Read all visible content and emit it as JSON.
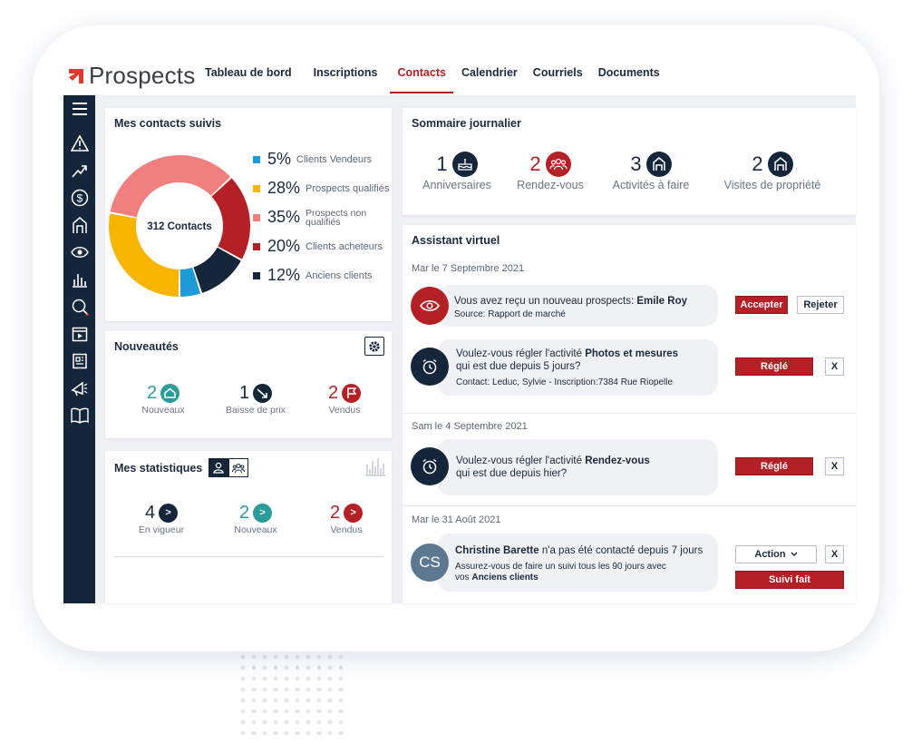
{
  "app": {
    "name": "Prospects"
  },
  "nav": {
    "items": [
      "Tableau de bord",
      "Inscriptions",
      "Contacts",
      "Calendrier",
      "Courriels",
      "Documents"
    ],
    "active": "Contacts"
  },
  "colors": {
    "accent": "#b32025",
    "navy": "#15253a",
    "teal": "#2a9d9b",
    "blue": "#1d9bd6",
    "yellow": "#f7b500",
    "salmon": "#f08080"
  },
  "contacts": {
    "title": "Mes contacts suivis",
    "center_label": "312 Contacts",
    "legend": [
      {
        "pct": "5%",
        "label": "Clients Vendeurs",
        "color": "#1d9bd6"
      },
      {
        "pct": "28%",
        "label": "Prospects qualifiés",
        "color": "#f7b500"
      },
      {
        "pct": "35%",
        "label": "Prospects non qualifiés",
        "color": "#f08080"
      },
      {
        "pct": "20%",
        "label": "Clients acheteurs",
        "color": "#b32025"
      },
      {
        "pct": "12%",
        "label": "Anciens clients",
        "color": "#15253a"
      }
    ]
  },
  "chart_data": {
    "type": "pie",
    "categories": [
      "Clients Vendeurs",
      "Prospects qualifiés",
      "Prospects non qualifiés",
      "Clients acheteurs",
      "Anciens clients"
    ],
    "values": [
      5,
      28,
      35,
      20,
      12
    ],
    "title": "Mes contacts suivis"
  },
  "news": {
    "title": "Nouveautés",
    "items": [
      {
        "num": "2",
        "label": "Nouveaux",
        "icon": "home-icon"
      },
      {
        "num": "1",
        "label": "Baisse de prix",
        "icon": "price-drop-icon"
      },
      {
        "num": "2",
        "label": "Vendus",
        "icon": "flag-icon"
      }
    ]
  },
  "stats": {
    "title": "Mes statistiques",
    "items": [
      {
        "num": "4",
        "label": "En vigueur",
        "badge": ">"
      },
      {
        "num": "2",
        "label": "Nouveaux",
        "badge": ">"
      },
      {
        "num": "2",
        "label": "Vendus",
        "badge": ">"
      }
    ]
  },
  "summary": {
    "title": "Sommaire journalier",
    "items": [
      {
        "num": "1",
        "label": "Anniversaires",
        "icon": "cake-icon"
      },
      {
        "num": "2",
        "label": "Rendez-vous",
        "icon": "people-icon"
      },
      {
        "num": "3",
        "label": "Activités à faire",
        "icon": "house-icon"
      },
      {
        "num": "2",
        "label": "Visites de propriété",
        "icon": "house-icon"
      }
    ]
  },
  "assistant": {
    "title": "Assistant virtuel",
    "groups": [
      {
        "date": "Mar le 7 Septembre 2021",
        "items": [
          {
            "pre": "Vous avez reçu un nouveau prospects: ",
            "bold": "Emile Roy",
            "post": "",
            "line2": "",
            "sub": "Source: Rapport de marché",
            "buttons": [
              "Accepter",
              "Rejeter"
            ]
          },
          {
            "pre": "Voulez-vous régler l'activité ",
            "bold": "Photos et mesures",
            "post": "",
            "line2": "qui est due depuis 5 jours?",
            "sub": "Contact: Leduc, Sylvie - Inscription:7384 Rue Riopelle",
            "buttons": [
              "Réglé",
              "X"
            ]
          }
        ]
      },
      {
        "date": "Sam le 4 Septembre 2021",
        "items": [
          {
            "pre": "Voulez-vous régler l'activité ",
            "bold": "Rendez-vous",
            "post": "",
            "line2": "qui est due depuis hier?",
            "sub": "",
            "buttons": [
              "Réglé",
              "X"
            ]
          }
        ]
      },
      {
        "date": "Mar le 31 Août 2021",
        "items": [
          {
            "pre": "",
            "bold": "Christine Barette",
            "post": " n'a pas été contacté depuis 7 jours",
            "line2": "Assurez-vous de faire un suivi tous les 90 jours avec",
            "line3_pre": "vos ",
            "line3_bold": "Anciens clients",
            "avatar": "CS",
            "buttons": [
              "Action",
              "X",
              "Suivi fait"
            ]
          }
        ]
      }
    ]
  }
}
